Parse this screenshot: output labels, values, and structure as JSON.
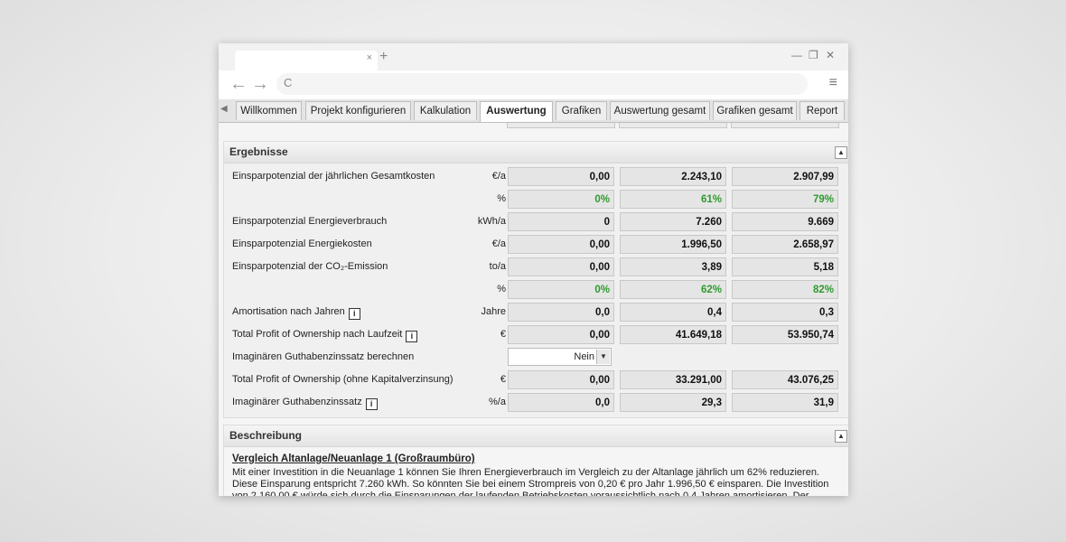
{
  "browser": {
    "tab_close": "×",
    "new_tab": "+",
    "minimize": "—",
    "restore": "❐",
    "close": "✕",
    "back": "←",
    "forward": "→",
    "reload": "C",
    "menu": "≡"
  },
  "app_tabs": [
    {
      "label": "Willkommen"
    },
    {
      "label": "Projekt konfigurieren"
    },
    {
      "label": "Kalkulation"
    },
    {
      "label": "Auswertung"
    },
    {
      "label": "Grafiken"
    },
    {
      "label": "Auswertung gesamt"
    },
    {
      "label": "Grafiken gesamt"
    },
    {
      "label": "Report"
    }
  ],
  "active_tab": "Auswertung",
  "ergebnisse": {
    "title": "Ergebnisse",
    "collapse_icon": "▲",
    "rows": [
      {
        "label": "Einsparpotenzial der jährlichen Gesamtkosten",
        "unit": "€/a",
        "values": [
          "0,00",
          "2.243,10",
          "2.907,99"
        ]
      },
      {
        "label": "",
        "unit": "%",
        "values": [
          "0%",
          "61%",
          "79%"
        ],
        "green": true
      },
      {
        "label": "Einsparpotenzial Energieverbrauch",
        "unit": "kWh/a",
        "values": [
          "0",
          "7.260",
          "9.669"
        ]
      },
      {
        "label": "Einsparpotenzial Energiekosten",
        "unit": "€/a",
        "values": [
          "0,00",
          "1.996,50",
          "2.658,97"
        ]
      },
      {
        "label": "Einsparpotenzial der CO₂-Emission",
        "unit": "to/a",
        "values": [
          "0,00",
          "3,89",
          "5,18"
        ]
      },
      {
        "label": "",
        "unit": "%",
        "values": [
          "0%",
          "62%",
          "82%"
        ],
        "green": true
      },
      {
        "label": "Amortisation nach Jahren",
        "info": true,
        "unit": "Jahre",
        "values": [
          "0,0",
          "0,4",
          "0,3"
        ]
      },
      {
        "label": "Total Profit of Ownership nach Laufzeit",
        "info": true,
        "unit": "€",
        "values": [
          "0,00",
          "41.649,18",
          "53.950,74"
        ]
      },
      {
        "label": "Imaginären Guthabenzinssatz berechnen",
        "unit": "",
        "select": "Nein"
      },
      {
        "label": "Total Profit of Ownership (ohne Kapitalverzinsung)",
        "unit": "€",
        "values": [
          "0,00",
          "33.291,00",
          "43.076,25"
        ]
      },
      {
        "label": "Imaginärer Guthabenzinssatz",
        "info": true,
        "unit": "%/a",
        "values": [
          "0,0",
          "29,3",
          "31,9"
        ]
      }
    ]
  },
  "beschreibung": {
    "title": "Beschreibung",
    "heading": "Vergleich Altanlage/Neuanlage 1 (Großraumbüro)",
    "text": "Mit einer Investition in die Neuanlage 1 können Sie Ihren Energieverbrauch im Vergleich zu der Altanlage jährlich um 62% reduzieren. Diese Einsparung entspricht 7.260 kWh. So könnten Sie bei einem Strompreis von 0,20 € pro Jahr 1.996,50 € einsparen. Die Investition von 2.160,00 € würde sich durch die Einsparungen der laufenden Betriebskosten voraussichtlich nach 0,4 Jahren amortisieren. Der Gewinn (Total Profit of"
  }
}
